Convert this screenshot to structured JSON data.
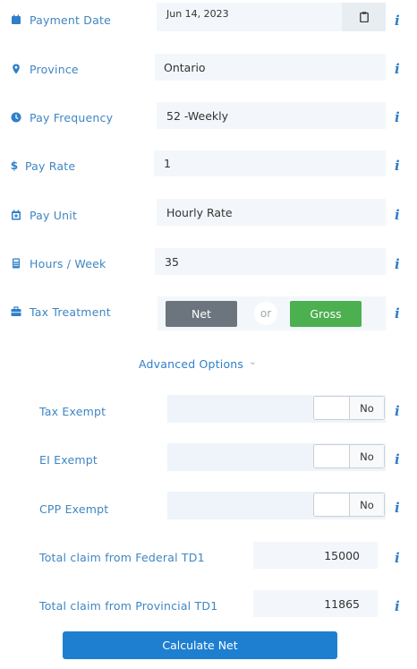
{
  "payment_date": {
    "label": "Payment Date",
    "value": "Jun 14, 2023"
  },
  "province": {
    "label": "Province",
    "value": "Ontario"
  },
  "pay_frequency": {
    "label": "Pay Frequency",
    "value": "52 -Weekly"
  },
  "pay_rate": {
    "label": "Pay Rate",
    "value": "1"
  },
  "pay_unit": {
    "label": "Pay Unit",
    "value": "Hourly Rate"
  },
  "hours_week": {
    "label": "Hours / Week",
    "value": "35"
  },
  "tax_treatment": {
    "label": "Tax Treatment",
    "net_label": "Net",
    "or_label": "or",
    "gross_label": "Gross"
  },
  "advanced": {
    "label": "Advanced Options",
    "chevron": "⌄"
  },
  "tax_exempt": {
    "label": "Tax Exempt",
    "value": "No"
  },
  "ei_exempt": {
    "label": "EI Exempt",
    "value": "No"
  },
  "cpp_exempt": {
    "label": "CPP Exempt",
    "value": "No"
  },
  "federal_td1": {
    "label": "Total claim from Federal TD1",
    "value": "15000"
  },
  "provincial_td1": {
    "label": "Total claim from Provincial TD1",
    "value": "11865"
  },
  "calculate": {
    "label": "Calculate Net"
  },
  "info_glyph": "i",
  "colors": {
    "accent": "#2f7fc8",
    "net_button": "#6c757d",
    "gross_button": "#4caf50",
    "calculate_button": "#1e7fd0",
    "field_bg": "#f3f7fb"
  }
}
